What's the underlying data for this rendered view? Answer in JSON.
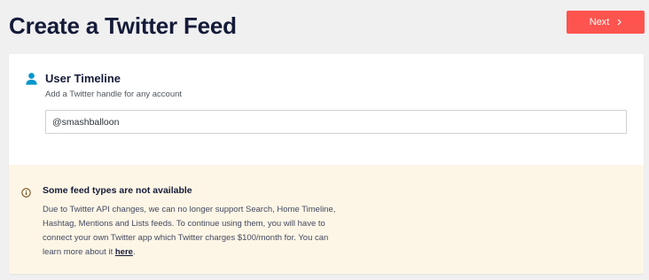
{
  "header": {
    "title": "Create a Twitter Feed",
    "next_label": "Next"
  },
  "timeline": {
    "icon": "user-icon",
    "title": "User Timeline",
    "description": "Add a Twitter handle for any account",
    "handle_value": "@smashballoon"
  },
  "notice": {
    "icon": "info-icon",
    "title": "Some feed types are not available",
    "body_text": "Due to Twitter API changes, we can no longer support Search, Home Timeline, Hashtag, Mentions and Lists feeds. To continue using them, you will have to connect your own Twitter app which Twitter charges $100/month for. You can learn more about it ",
    "link_text": "here",
    "body_end": "."
  },
  "colors": {
    "accent": "#fe544f",
    "user_icon": "#0096cc",
    "notice_background": "#fdf6e6",
    "page_background": "#f0f0f1"
  }
}
